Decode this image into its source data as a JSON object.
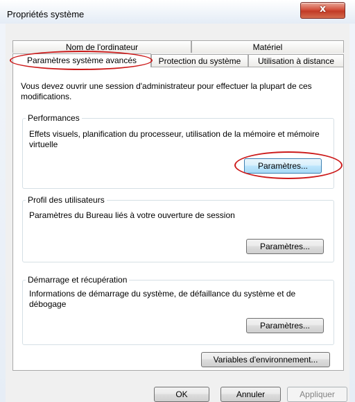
{
  "window": {
    "title": "Propriétés système",
    "close_label": "x"
  },
  "tabs": {
    "row_top": [
      {
        "label": "Nom de l'ordinateur"
      },
      {
        "label": "Matériel"
      }
    ],
    "row_bottom": [
      {
        "label": "Paramètres système avancés",
        "selected": true
      },
      {
        "label": "Protection du système"
      },
      {
        "label": "Utilisation à distance"
      }
    ]
  },
  "intro_text": "Vous devez ouvrir une session d'administrateur pour effectuer la plupart de ces modifications.",
  "groups": {
    "performance": {
      "title": "Performances",
      "description": "Effets visuels, planification du processeur, utilisation de la mémoire et mémoire virtuelle",
      "button_label": "Paramètres..."
    },
    "user_profiles": {
      "title": "Profil des utilisateurs",
      "description": "Paramètres du Bureau liés à votre ouverture de session",
      "button_label": "Paramètres..."
    },
    "startup_recovery": {
      "title": "Démarrage et récupération",
      "description": "Informations de démarrage du système, de défaillance du système et de débogage",
      "button_label": "Paramètres..."
    }
  },
  "env_button_label": "Variables d'environnement...",
  "footer": {
    "ok_label": "OK",
    "cancel_label": "Annuler",
    "apply_label": "Appliquer"
  },
  "annotation_color": "#cc1a1a"
}
